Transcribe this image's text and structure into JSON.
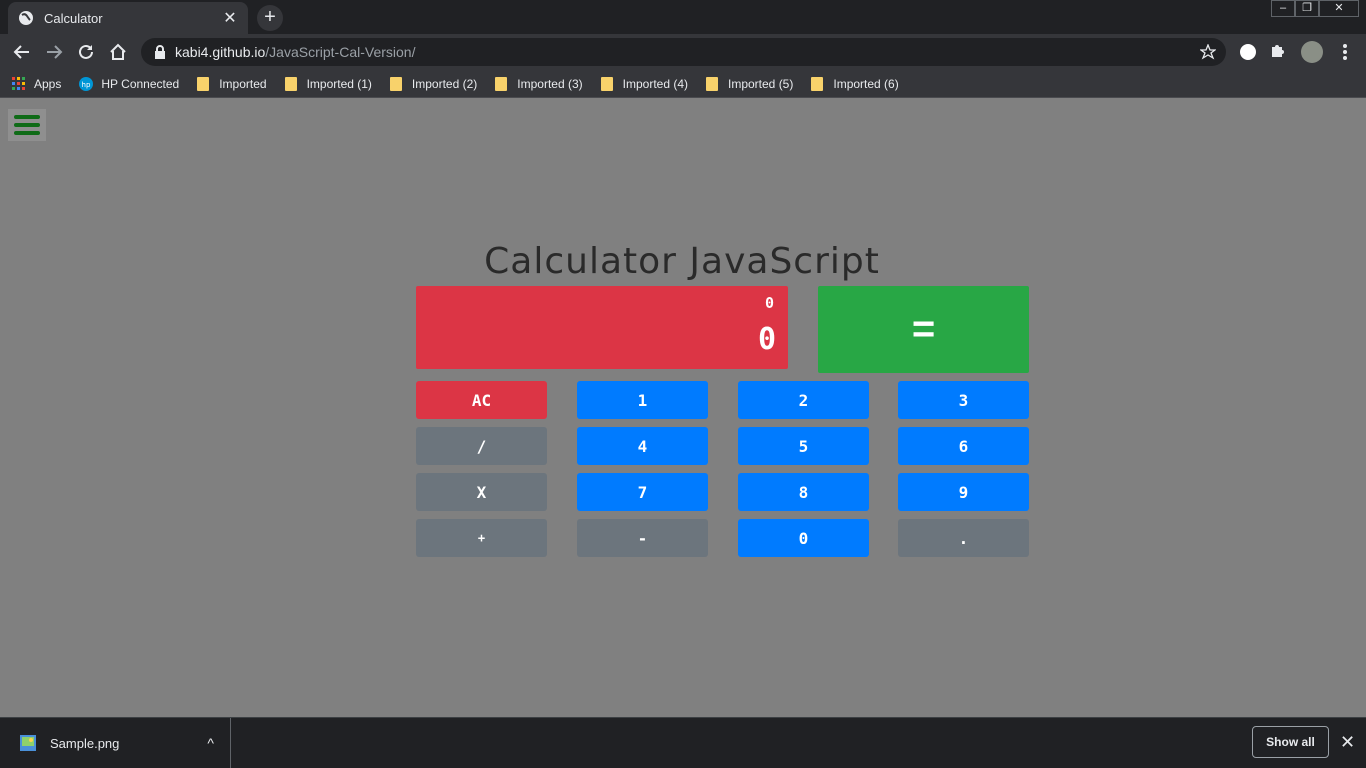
{
  "browser": {
    "tab_title": "Calculator",
    "tab_close": "✕",
    "new_tab": "+",
    "window_controls": {
      "minimize": "–",
      "restore": "❐",
      "close": "✕"
    },
    "url_host": "kabi4.github.io",
    "url_path": "/JavaScript-Cal-Version/",
    "bookmarks": [
      {
        "label": "Apps",
        "icon": "apps-grid-icon"
      },
      {
        "label": "HP Connected",
        "icon": "hp-logo-icon"
      },
      {
        "label": "Imported",
        "icon": "folder-icon"
      },
      {
        "label": "Imported (1)",
        "icon": "folder-icon"
      },
      {
        "label": "Imported (2)",
        "icon": "folder-icon"
      },
      {
        "label": "Imported (3)",
        "icon": "folder-icon"
      },
      {
        "label": "Imported (4)",
        "icon": "folder-icon"
      },
      {
        "label": "Imported (5)",
        "icon": "folder-icon"
      },
      {
        "label": "Imported (6)",
        "icon": "folder-icon"
      }
    ]
  },
  "page": {
    "title": "Calculator JavaScript",
    "display": {
      "previous": "0",
      "current": "0"
    },
    "equals_label": "=",
    "keys": [
      {
        "label": "AC",
        "style": "red"
      },
      {
        "label": "1",
        "style": "blue"
      },
      {
        "label": "2",
        "style": "blue"
      },
      {
        "label": "3",
        "style": "blue"
      },
      {
        "label": "/",
        "style": "grey"
      },
      {
        "label": "4",
        "style": "blue"
      },
      {
        "label": "5",
        "style": "blue"
      },
      {
        "label": "6",
        "style": "blue"
      },
      {
        "label": "X",
        "style": "grey"
      },
      {
        "label": "7",
        "style": "blue"
      },
      {
        "label": "8",
        "style": "blue"
      },
      {
        "label": "9",
        "style": "blue"
      },
      {
        "label": "+",
        "style": "grey"
      },
      {
        "label": "-",
        "style": "grey"
      },
      {
        "label": "0",
        "style": "blue"
      },
      {
        "label": ".",
        "style": "grey"
      }
    ],
    "colors": {
      "display": "#dc3545",
      "equals": "#28a745",
      "number_key": "#007bff",
      "operator_key": "#6c757d",
      "hamburger": "#0f6b17"
    }
  },
  "downloads": {
    "file_name": "Sample.png",
    "chevron": "^",
    "show_all": "Show all",
    "close": "✕"
  }
}
